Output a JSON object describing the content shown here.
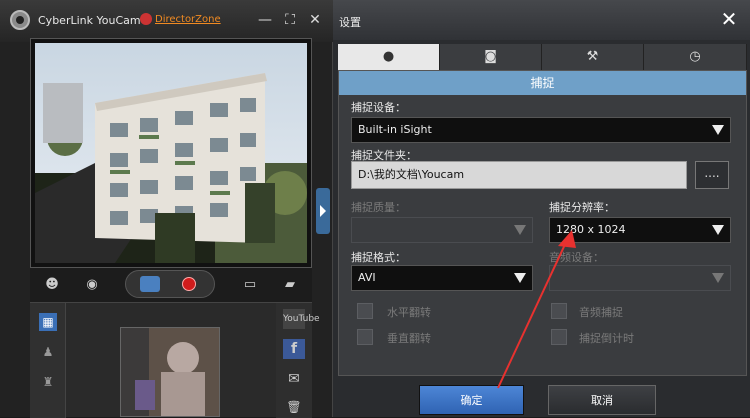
{
  "youcam": {
    "app_title": "CyberLink YouCam 4",
    "director_zone": "DirectorZone",
    "min": "—",
    "full": "⛶",
    "close": "✕",
    "thumb_labels": [
      "YouTube",
      "f",
      "✉",
      "🗑"
    ]
  },
  "dialog": {
    "title": "设置",
    "close": "✕",
    "tabs": [
      "●",
      "◙",
      "⚒",
      "◷"
    ],
    "section_title": "捕捉",
    "capture_device_label": "捕捉设备：",
    "capture_device_value": "Built-in iSight",
    "capture_folder_label": "捕捉文件夹：",
    "capture_folder_value": "D:\\我的文档\\Youcam",
    "browse_label": "....",
    "capture_quality_label": "捕捉质量：",
    "capture_resolution_label": "捕捉分辨率：",
    "capture_resolution_value": "1280 x 1024",
    "capture_format_label": "捕捉格式：",
    "capture_format_value": "AVI",
    "audio_device_label": "音频设备：",
    "flip_horizontal": "水平翻转",
    "flip_vertical": "垂直翻转",
    "audio_capture": "音频捕捉",
    "capture_timer": "捕捉倒计时",
    "ok": "确定",
    "cancel": "取消"
  },
  "colors": {
    "accent": "#6fa0c8",
    "ok_button": "#3a73c4",
    "arrow": "#e8312f"
  }
}
